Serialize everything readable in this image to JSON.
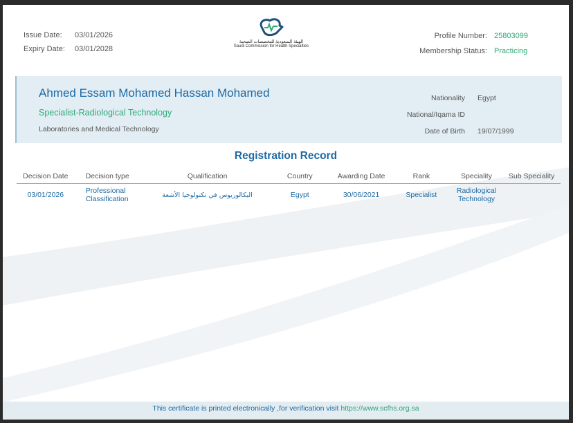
{
  "header": {
    "issue_date_label": "Issue Date:",
    "issue_date": "03/01/2026",
    "expiry_date_label": "Expiry Date:",
    "expiry_date": "03/01/2028",
    "profile_number_label": "Profile Number:",
    "profile_number": "25803099",
    "membership_status_label": "Membership Status:",
    "membership_status": "Practicing",
    "logo_arabic": "الهيئة السعودية للتخصصات الصحية",
    "logo_english": "Saudi Commission for Health Specialties"
  },
  "profile": {
    "name": "Ahmed Essam Mohamed Hassan Mohamed",
    "specialty": "Specialist-Radiological Technology",
    "department": "Laboratories and Medical Technology",
    "nationality_label": "Nationality",
    "nationality": "Egypt",
    "national_id_label": "National/Iqama ID",
    "national_id": "",
    "dob_label": "Date of Birth",
    "dob": "19/07/1999"
  },
  "registration": {
    "title": "Registration Record",
    "columns": [
      "Decision Date",
      "Decision type",
      "Qualification",
      "Country",
      "Awarding Date",
      "Rank",
      "Speciality",
      "Sub Speciality"
    ],
    "rows": [
      {
        "decision_date": "03/01/2026",
        "decision_type": "Professional Classification",
        "qualification": "البكالوريوس في تكنولوجيا الأشعة",
        "country": "Egypt",
        "awarding_date": "30/06/2021",
        "rank": "Specialist",
        "speciality": "Radiological Technology",
        "sub_speciality": ""
      }
    ]
  },
  "footer": {
    "text": "This certificate is printed electronically ,for verification visit ",
    "link": "https://www.scfhs.org.sa"
  },
  "colors": {
    "primary_blue": "#1d6aa3",
    "accent_green": "#2fa978",
    "panel_bg": "#e2edf4"
  }
}
